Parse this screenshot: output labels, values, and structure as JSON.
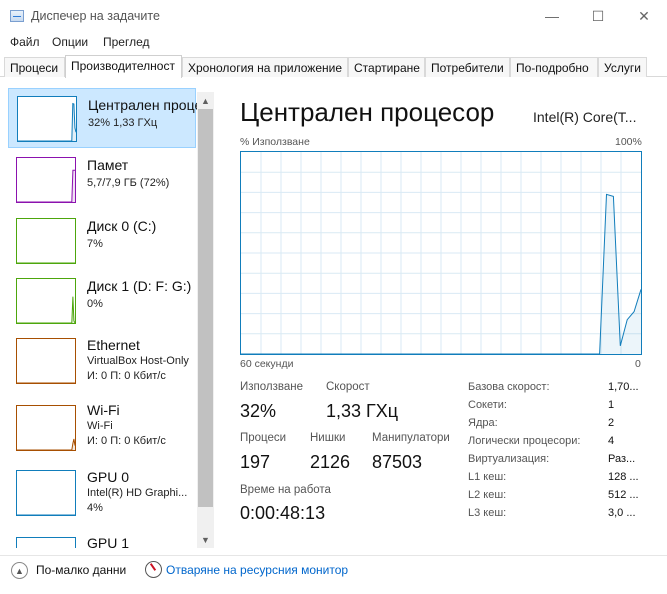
{
  "window": {
    "title": "Диспечер на задачите",
    "minimize_glyph": "—",
    "maximize_glyph": "☐",
    "close_glyph": "✕"
  },
  "menu": [
    "Файл",
    "Опции",
    "Преглед"
  ],
  "tabs": [
    "Процеси",
    "Производителност",
    "Хронология на приложение",
    "Стартиране",
    "Потребители",
    "По-подробно",
    "Услуги"
  ],
  "active_tab": "Производителност",
  "sidebar": {
    "items": [
      {
        "name": "Централен процесор",
        "line1": "32% 1,33 ГХц",
        "line2": "",
        "color": "#117dbb",
        "selected": true,
        "history": [
          0,
          0,
          0,
          0,
          0,
          0,
          0,
          0,
          0,
          0,
          0,
          0,
          0,
          0,
          0,
          0,
          0,
          0,
          0,
          0,
          0,
          0,
          0,
          0,
          0,
          0,
          0,
          0,
          0,
          0,
          0,
          0,
          0,
          0,
          0,
          0,
          0,
          0,
          0,
          0,
          0,
          0,
          0,
          0,
          0,
          0,
          0,
          0,
          0,
          0,
          0,
          0,
          85,
          84,
          30,
          20
        ]
      },
      {
        "name": "Памет",
        "line1": "5,7/7,9 ГБ (72%)",
        "line2": "",
        "color": "#8b12ae",
        "selected": false,
        "history": [
          0,
          0,
          0,
          0,
          0,
          0,
          0,
          0,
          0,
          0,
          0,
          0,
          0,
          0,
          0,
          0,
          0,
          0,
          0,
          0,
          0,
          0,
          0,
          0,
          0,
          0,
          0,
          0,
          0,
          0,
          0,
          0,
          0,
          0,
          0,
          0,
          0,
          0,
          0,
          0,
          0,
          0,
          0,
          0,
          0,
          0,
          0,
          0,
          0,
          0,
          0,
          0,
          0,
          72,
          72,
          72
        ]
      },
      {
        "name": "Диск 0 (C:)",
        "line1": "7%",
        "line2": "",
        "color": "#4da60c",
        "selected": false,
        "history": [
          0,
          0,
          0,
          0,
          0,
          0,
          0,
          0,
          0,
          0,
          0,
          0,
          0,
          0,
          0,
          0,
          0,
          0,
          0,
          0,
          0,
          0,
          0,
          0,
          0,
          0,
          0,
          0,
          0,
          0,
          0,
          0,
          0,
          0,
          0,
          0,
          0,
          0,
          0,
          0,
          0,
          0,
          0,
          0,
          0,
          0,
          0,
          0,
          0,
          0,
          0,
          0,
          0,
          0,
          0,
          0
        ]
      },
      {
        "name": "Диск 1 (D: F: G:)",
        "line1": "0%",
        "line2": "",
        "color": "#4da60c",
        "selected": false,
        "history": [
          0,
          0,
          0,
          0,
          0,
          0,
          0,
          0,
          0,
          0,
          0,
          0,
          0,
          0,
          0,
          0,
          0,
          0,
          0,
          0,
          0,
          0,
          0,
          0,
          0,
          0,
          0,
          0,
          0,
          0,
          0,
          0,
          0,
          0,
          0,
          0,
          0,
          0,
          0,
          0,
          0,
          0,
          0,
          0,
          0,
          0,
          0,
          0,
          0,
          0,
          0,
          0,
          0,
          60,
          5,
          0
        ]
      },
      {
        "name": "Ethernet",
        "line1": "VirtualBox Host-Only",
        "line2": "И: 0 П: 0 Кбит/с",
        "color": "#a74f01",
        "selected": false,
        "history": [
          0,
          0,
          0,
          0,
          0,
          0,
          0,
          0,
          0,
          0,
          0,
          0,
          0,
          0,
          0,
          0,
          0,
          0,
          0,
          0,
          0,
          0,
          0,
          0,
          0,
          0,
          0,
          0,
          0,
          0,
          0,
          0,
          0,
          0,
          0,
          0,
          0,
          0,
          0,
          0,
          0,
          0,
          0,
          0,
          0,
          0,
          0,
          0,
          0,
          0,
          0,
          0,
          0,
          0,
          0,
          0
        ]
      },
      {
        "name": "Wi-Fi",
        "line1": "Wi-Fi",
        "line2": "И: 0 П: 0 Кбит/с",
        "color": "#a74f01",
        "selected": false,
        "history": [
          0,
          0,
          0,
          0,
          0,
          0,
          0,
          0,
          0,
          0,
          0,
          0,
          0,
          0,
          0,
          0,
          0,
          0,
          0,
          0,
          0,
          0,
          0,
          0,
          0,
          0,
          0,
          0,
          0,
          0,
          0,
          0,
          0,
          0,
          0,
          0,
          0,
          0,
          0,
          0,
          0,
          0,
          0,
          0,
          0,
          0,
          0,
          0,
          0,
          0,
          0,
          0,
          0,
          15,
          25,
          10
        ]
      },
      {
        "name": "GPU 0",
        "line1": "Intel(R) HD Graphi...",
        "line2": "4%",
        "color": "#117dbb",
        "selected": false,
        "history": [
          0,
          0,
          0,
          0,
          0,
          0,
          0,
          0,
          0,
          0,
          0,
          0,
          0,
          0,
          0,
          0,
          0,
          0,
          0,
          0,
          0,
          0,
          0,
          0,
          0,
          0,
          0,
          0,
          0,
          0,
          0,
          0,
          0,
          0,
          0,
          0,
          0,
          0,
          0,
          0,
          0,
          0,
          0,
          0,
          0,
          0,
          0,
          0,
          0,
          0,
          0,
          0,
          0,
          0,
          0,
          0
        ]
      },
      {
        "name": "GPU 1",
        "line1": "",
        "line2": "",
        "color": "#117dbb",
        "selected": false,
        "history": []
      }
    ]
  },
  "main": {
    "title": "Централен процесор",
    "cpu_model": "Intel(R) Core(T...",
    "graph_top_left": "% Използване",
    "graph_top_right": "100%",
    "graph_bottom_left": "60 секунди",
    "graph_bottom_right": "0",
    "stats": {
      "usage_label": "Използване",
      "usage_value": "32%",
      "speed_label": "Скорост",
      "speed_value": "1,33 ГХц",
      "processes_label": "Процеси",
      "processes_value": "197",
      "threads_label": "Нишки",
      "threads_value": "2126",
      "handles_label": "Манипулатори",
      "handles_value": "87503",
      "uptime_label": "Време на работа",
      "uptime_value": "0:00:48:13"
    },
    "details": [
      {
        "label": "Базова скорост:",
        "value": "1,70..."
      },
      {
        "label": "Сокети:",
        "value": "1"
      },
      {
        "label": "Ядра:",
        "value": "2"
      },
      {
        "label": "Логически процесори:",
        "value": "4"
      },
      {
        "label": "Виртуализация:",
        "value": "Раз..."
      },
      {
        "label": "L1 кеш:",
        "value": "128 ..."
      },
      {
        "label": "L2 кеш:",
        "value": "512 ..."
      },
      {
        "label": "L3 кеш:",
        "value": "3,0 ..."
      }
    ]
  },
  "cpu_history": [
    0,
    0,
    0,
    0,
    0,
    0,
    0,
    0,
    0,
    0,
    0,
    0,
    0,
    0,
    0,
    0,
    0,
    0,
    0,
    0,
    0,
    0,
    0,
    0,
    0,
    0,
    0,
    0,
    0,
    0,
    0,
    0,
    0,
    0,
    0,
    0,
    0,
    0,
    0,
    0,
    0,
    0,
    0,
    0,
    0,
    0,
    0,
    0,
    0,
    0,
    0,
    0,
    0,
    79,
    78,
    4,
    17,
    21,
    32
  ],
  "footer": {
    "fewer_details": "По-малко данни",
    "resource_monitor": "Отваряне на ресурсния монитор"
  }
}
